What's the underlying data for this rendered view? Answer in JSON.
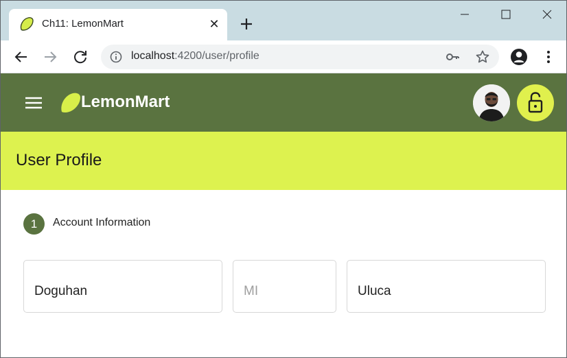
{
  "browser": {
    "tab_title": "Ch11: LemonMart",
    "url_host": "localhost",
    "url_rest": ":4200/user/profile"
  },
  "app": {
    "title": "LemonMart",
    "page_title": "User Profile"
  },
  "stepper": {
    "step_number": "1",
    "step_label": "Account Information"
  },
  "form": {
    "first_name": "Doguhan",
    "middle_initial_placeholder": "MI",
    "last_name": "Uluca"
  },
  "icons": [
    "lemon-icon",
    "tab-close-icon",
    "plus-icon",
    "minimize-icon",
    "maximize-icon",
    "close-icon",
    "back-arrow-icon",
    "forward-arrow-icon",
    "reload-icon",
    "info-icon",
    "key-icon",
    "star-icon",
    "account-icon",
    "kebab-menu-icon",
    "hamburger-menu-icon",
    "lock-open-icon"
  ],
  "colors": {
    "tab_strip": "#c9dce2",
    "app_bar": "#5a7340",
    "page_header": "#ddf24f",
    "accent_lemon": "#e0f04d"
  }
}
